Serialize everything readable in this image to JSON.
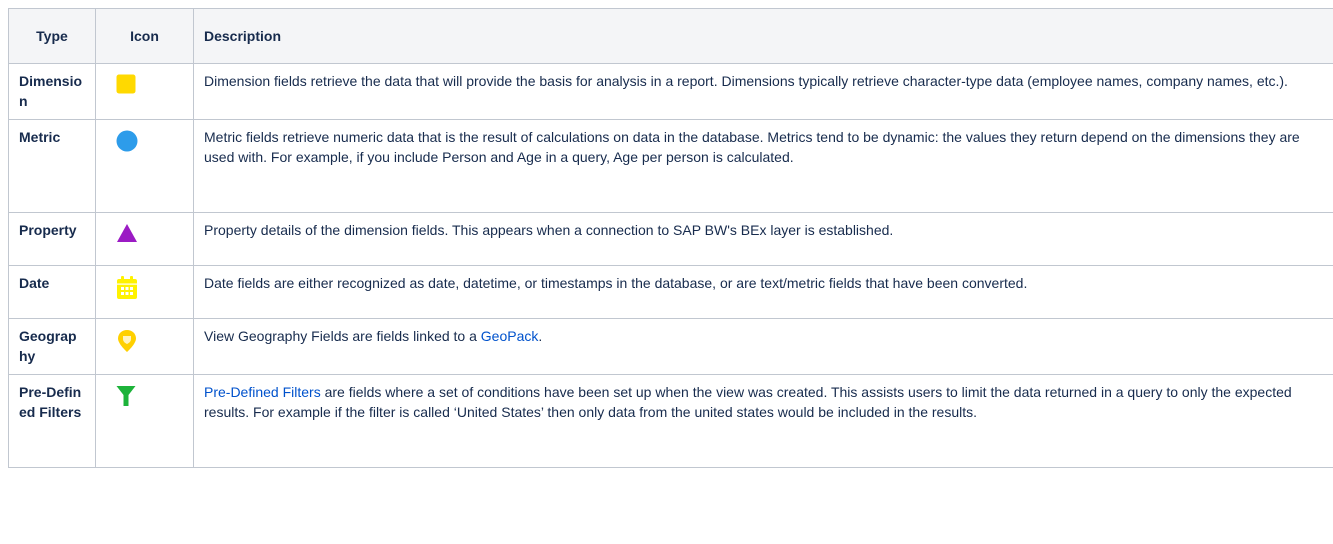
{
  "header": {
    "type": "Type",
    "icon": "Icon",
    "description": "Description"
  },
  "rows": [
    {
      "type": "Dimension",
      "icon": "yellow-square-icon",
      "description": "Dimension fields retrieve the data that will provide the basis for analysis in a report. Dimensions typically retrieve character-type data (employee names, company names, etc.)."
    },
    {
      "type": "Metric",
      "icon": "blue-circle-icon",
      "description": "Metric fields retrieve numeric data that is the result of calculations on data in the database. Metrics tend to be dynamic: the values they return depend on the dimensions they are used with. For example, if you include Person and Age in a query, Age per person is calculated."
    },
    {
      "type": "Property",
      "icon": "purple-triangle-icon",
      "description": "Property details of the dimension fields. This appears when a connection to SAP BW's BEx layer is established."
    },
    {
      "type": "Date",
      "icon": "calendar-icon",
      "description": "Date fields are either recognized as date, datetime, or timestamps in the database, or are text/metric fields that have been converted."
    },
    {
      "type": "Geography",
      "icon": "map-pin-icon",
      "description_before": "View Geography Fields are fields linked to a ",
      "description_link": "GeoPack",
      "description_after": "."
    },
    {
      "type": "Pre-Defined Filters",
      "icon": "funnel-icon",
      "description_link": "Pre-Defined Filters",
      "description_after": " are fields where a set of conditions have been set up when the view was created. This assists users to limit the data returned in a query to only the expected results. For example if the filter is called ‘United States’ then only data from the united states would be included in the results."
    }
  ],
  "colors": {
    "dimension": "#ffd900",
    "metric": "#2d9cea",
    "property": "#9b1bc4",
    "date": "#fff200",
    "geography": "#ffd000",
    "filter": "#1db33a",
    "link": "#0052cc"
  }
}
